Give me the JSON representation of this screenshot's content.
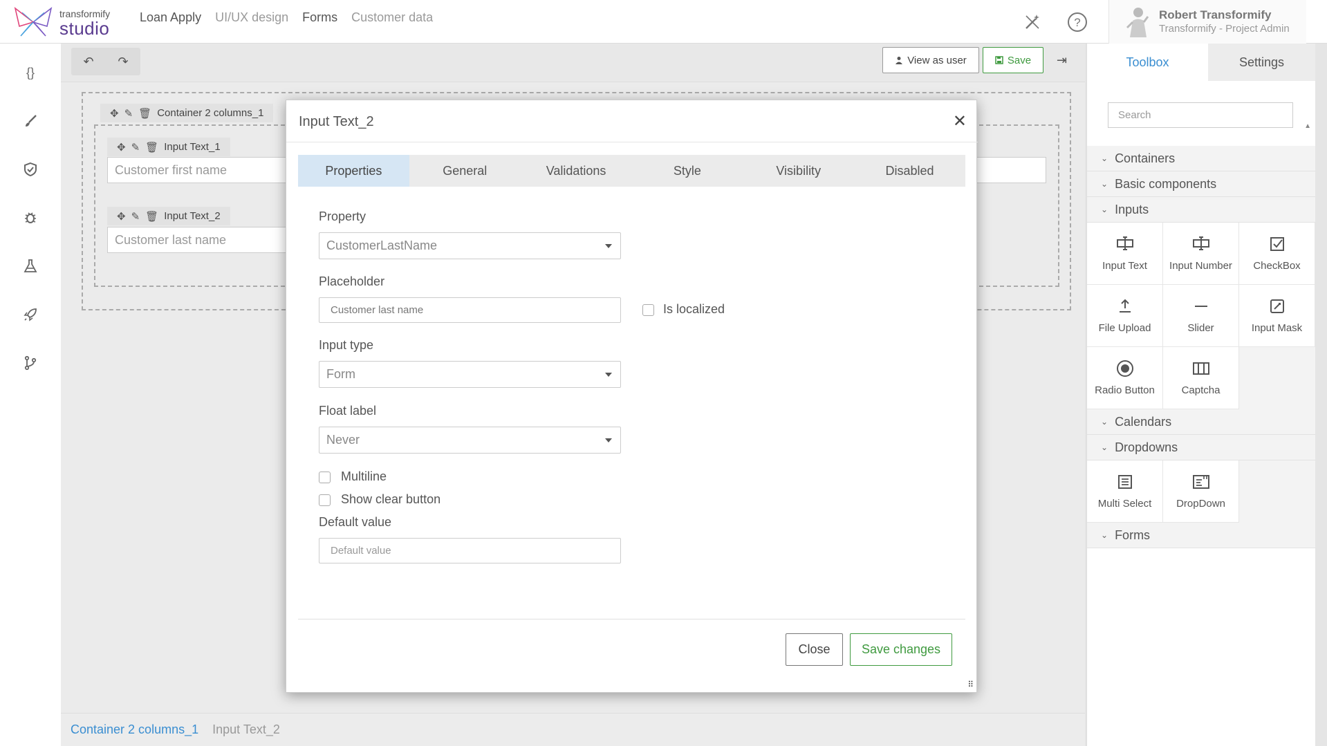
{
  "app": {
    "logo_line1": "transformify",
    "logo_line2": "studio",
    "nav": [
      "Loan Apply",
      "UI/UX design",
      "Forms",
      "Customer data"
    ]
  },
  "user": {
    "name": "Robert Transformify",
    "role": "Transformify - Project Admin"
  },
  "toolbar": {
    "view_as_user": "View as user",
    "save": "Save"
  },
  "canvas": {
    "container_tag": "Container 2 columns_1",
    "input1_tag": "Input Text_1",
    "input1_placeholder": "Customer first name",
    "input2_tag": "Input Text_2",
    "input2_placeholder": "Customer last name"
  },
  "breadcrumb": [
    "Container 2 columns_1",
    "Input Text_2"
  ],
  "panel": {
    "tabs": [
      "Toolbox",
      "Settings"
    ],
    "search_placeholder": "Search",
    "sections": [
      "Containers",
      "Basic components",
      "Inputs",
      "Calendars",
      "Dropdowns",
      "Forms"
    ],
    "inputs_items": [
      "Input Text",
      "Input Number",
      "CheckBox",
      "File Upload",
      "Slider",
      "Input Mask",
      "Radio Button",
      "Captcha"
    ],
    "dropdown_items": [
      "Multi Select",
      "DropDown"
    ]
  },
  "modal": {
    "title": "Input Text_2",
    "tabs": [
      "Properties",
      "General",
      "Validations",
      "Style",
      "Visibility",
      "Disabled"
    ],
    "property_label": "Property",
    "property_value": "CustomerLastName",
    "placeholder_label": "Placeholder",
    "placeholder_value": "Customer last name",
    "is_localized_label": "Is localized",
    "input_type_label": "Input type",
    "input_type_value": "Form",
    "float_label_label": "Float label",
    "float_label_value": "Never",
    "multiline_label": "Multiline",
    "show_clear_label": "Show clear button",
    "default_value_label": "Default value",
    "default_value_placeholder": "Default value",
    "close_button": "Close",
    "save_changes_button": "Save changes"
  },
  "colors": {
    "accent_blue": "#3a8ed1",
    "accent_green": "#3f9a3f",
    "brand_purple": "#5a3b8f",
    "active_tab_bg": "#d6e6f4"
  }
}
